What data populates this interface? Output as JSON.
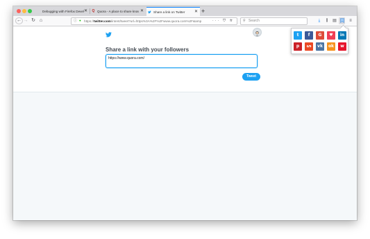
{
  "browser": {
    "tabs": [
      {
        "title": "Debugging with Firefox Developer",
        "icon": "firefox-devtools-icon",
        "active": false
      },
      {
        "title": "Quora - A place to share knowl",
        "icon": "quora-icon",
        "active": false
      },
      {
        "title": "Share a link on Twitter",
        "icon": "twitter-icon",
        "active": true
      }
    ],
    "new_tab_label": "+",
    "url_prefix": "https://",
    "url_domain": "twitter.com",
    "url_rest": "/intent/tweet?url=https%3A%2F%2Fwww.quora.com%2F&amp",
    "url_actions": "··· ⛉ ☆",
    "search_placeholder": "Search"
  },
  "page": {
    "share_title": "Share a link with your followers",
    "tweet_text": "https://www.quora.com/",
    "tweet_button": "Tweet"
  },
  "share_popup": {
    "buttons": [
      {
        "name": "twitter",
        "glyph": "t",
        "color": "#1da1f2"
      },
      {
        "name": "facebook",
        "glyph": "f",
        "color": "#3b5998"
      },
      {
        "name": "google-plus",
        "glyph": "G",
        "color": "#dd4b39"
      },
      {
        "name": "pocket",
        "glyph": "♥",
        "color": "#ef4056"
      },
      {
        "name": "linkedin",
        "glyph": "in",
        "color": "#0077b5"
      },
      {
        "name": "pinterest",
        "glyph": "p",
        "color": "#cb2027"
      },
      {
        "name": "stumbleupon",
        "glyph": "ᔕ",
        "color": "#eb4924"
      },
      {
        "name": "vk",
        "glyph": "vk",
        "color": "#4c75a3"
      },
      {
        "name": "odnoklassniki",
        "glyph": "ok",
        "color": "#f7931e"
      },
      {
        "name": "weibo",
        "glyph": "w",
        "color": "#e6162d"
      }
    ]
  },
  "colors": {
    "twitter_blue": "#1da1f2",
    "tab_strip": "#d7d7db",
    "page_bg": "#f5f8fa"
  }
}
